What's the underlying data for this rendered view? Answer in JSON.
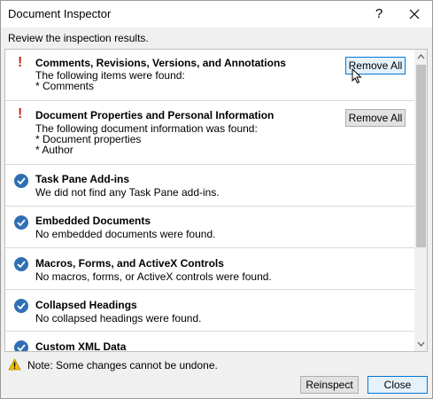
{
  "window": {
    "title": "Document Inspector",
    "help_label": "?"
  },
  "subtitle": "Review the inspection results.",
  "results": [
    {
      "status": "issue",
      "title": "Comments, Revisions, Versions, and Annotations",
      "lines": [
        "The following items were found:",
        "* Comments"
      ],
      "button": "Remove All"
    },
    {
      "status": "issue",
      "title": "Document Properties and Personal Information",
      "lines": [
        "The following document information was found:",
        "* Document properties",
        "* Author"
      ],
      "button": "Remove All"
    },
    {
      "status": "ok",
      "title": "Task Pane Add-ins",
      "lines": [
        "We did not find any Task Pane add-ins."
      ]
    },
    {
      "status": "ok",
      "title": "Embedded Documents",
      "lines": [
        "No embedded documents were found."
      ]
    },
    {
      "status": "ok",
      "title": "Macros, Forms, and ActiveX Controls",
      "lines": [
        "No macros, forms, or ActiveX controls were found."
      ]
    },
    {
      "status": "ok",
      "title": "Collapsed Headings",
      "lines": [
        "No collapsed headings were found."
      ]
    },
    {
      "status": "ok",
      "title": "Custom XML Data",
      "lines": []
    }
  ],
  "note": "Note: Some changes cannot be undone.",
  "footer": {
    "reinspect_label": "Reinspect",
    "close_label": "Close"
  },
  "colors": {
    "issue": "#c42b1c",
    "ok": "#2f6fb3",
    "accent": "#0078d7"
  },
  "icons": {
    "issue": "exclamation-icon",
    "ok": "checkmark-icon",
    "note": "warning-icon",
    "close": "close-icon"
  }
}
